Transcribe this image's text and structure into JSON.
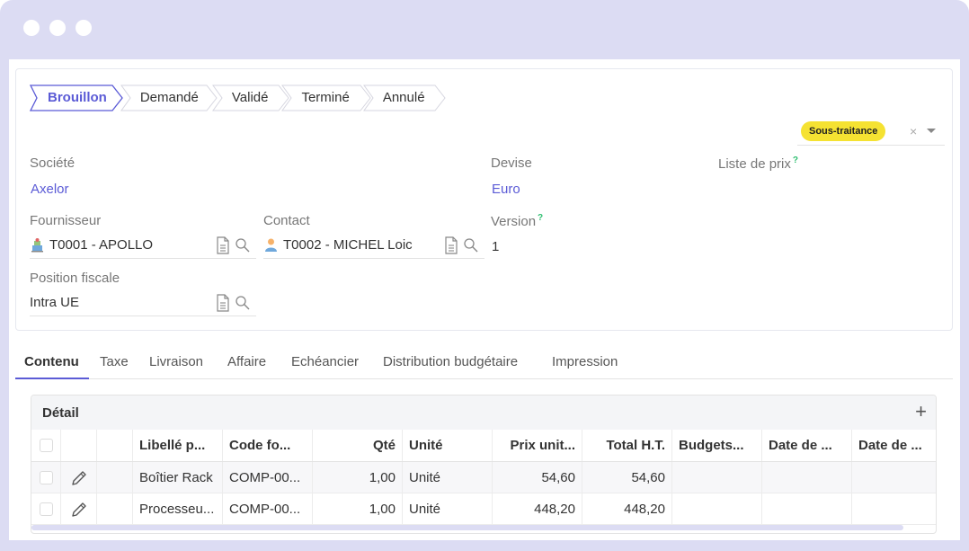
{
  "window": {
    "dots": 3
  },
  "status_steps": [
    {
      "label": "Brouillon",
      "active": true
    },
    {
      "label": "Demandé",
      "active": false
    },
    {
      "label": "Validé",
      "active": false
    },
    {
      "label": "Terminé",
      "active": false
    },
    {
      "label": "Annulé",
      "active": false
    }
  ],
  "tag": {
    "label": "Sous-traitance",
    "clear": "×"
  },
  "fields": {
    "societe": {
      "label": "Société",
      "value": "Axelor"
    },
    "devise": {
      "label": "Devise",
      "value": "Euro"
    },
    "liste_prix": {
      "label": "Liste de prix",
      "help": "?"
    },
    "fournisseur": {
      "label": "Fournisseur",
      "value": "T0001 - APOLLO"
    },
    "contact": {
      "label": "Contact",
      "value": "T0002 - MICHEL Loic"
    },
    "version": {
      "label": "Version",
      "help": "?",
      "value": "1"
    },
    "position_fiscale": {
      "label": "Position fiscale",
      "value": "Intra UE"
    }
  },
  "tabs": [
    "Contenu",
    "Taxe",
    "Livraison",
    "Affaire",
    "Echéancier",
    "Distribution budgétaire",
    "Impression"
  ],
  "panel": {
    "title": "Détail",
    "add": "+",
    "columns": [
      "Libellé p...",
      "Code fo...",
      "Qté",
      "Unité",
      "Prix unit...",
      "Total H.T.",
      "Budgets...",
      "Date de ...",
      "Date de ..."
    ],
    "rows": [
      [
        "Boîtier Rack",
        "COMP-00...",
        "1,00",
        "Unité",
        "54,60",
        "54,60",
        "",
        "",
        ""
      ],
      [
        "Processeu...",
        "COMP-00...",
        "1,00",
        "Unité",
        "448,20",
        "448,20",
        "",
        "",
        ""
      ]
    ]
  },
  "colors": {
    "accent": "#5b5bd6",
    "tag": "#f5e232",
    "frame": "#dcdcf3",
    "help": "#2fbf71"
  }
}
